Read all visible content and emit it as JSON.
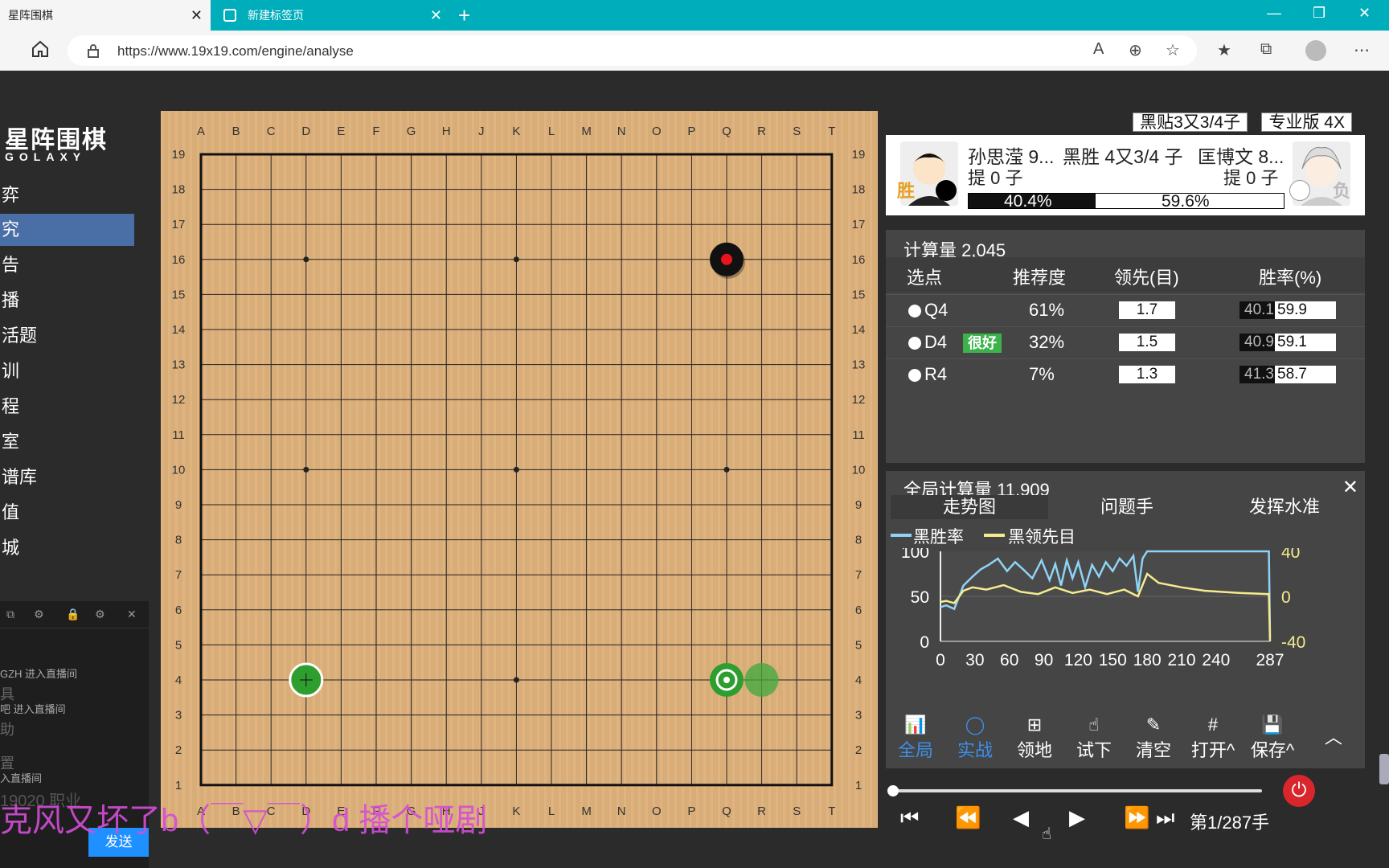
{
  "browser": {
    "tabs": [
      {
        "title": "星阵围棋",
        "active": true
      },
      {
        "title": "新建标签页",
        "active": false
      }
    ],
    "new_tab": "+",
    "url": "https://www.19x19.com/engine/analyse",
    "controls": {
      "minimize": "—",
      "restore": "❐",
      "close": "✕"
    }
  },
  "sidebar": {
    "logo": "星阵围棋",
    "logo_sub": "GOLAXY",
    "nav": [
      "弈",
      "究",
      "告",
      "播",
      "活题",
      "训",
      "程",
      "室",
      "谱库",
      "值",
      "城"
    ],
    "active_index": 1
  },
  "chat": {
    "lines": [
      "GZH 进入直播间",
      "具",
      "吧 进入直播间",
      "助",
      "置",
      "入直播间",
      "19020 职业"
    ],
    "send_label": "发送"
  },
  "board": {
    "size": 19,
    "columns": [
      "A",
      "B",
      "C",
      "D",
      "E",
      "F",
      "G",
      "H",
      "J",
      "K",
      "L",
      "M",
      "N",
      "O",
      "P",
      "Q",
      "R",
      "S",
      "T"
    ],
    "stones": [
      {
        "point": "Q16",
        "color": "black",
        "last_move": true
      }
    ],
    "candidates": [
      {
        "point": "D4",
        "style": "green-ring"
      },
      {
        "point": "Q4",
        "style": "green-best"
      },
      {
        "point": "R4",
        "style": "green-soft"
      }
    ]
  },
  "panel": {
    "komi_badge": "黑贴3又3/4子",
    "version_badge": "专业版 4X",
    "black_player": {
      "name": "孙思滢 9...",
      "captures": "提 0 子",
      "badge": "胜"
    },
    "white_player": {
      "name": "匡博文 8...",
      "captures": "提 0 子",
      "badge": "负"
    },
    "result": "黑胜 4又3/4 子",
    "black_winrate": "40.4%",
    "white_winrate": "59.6%",
    "black_winrate_value": 40.4,
    "analysis": {
      "title": "计算量 2,045",
      "headers": [
        "选点",
        "推荐度",
        "领先(目)",
        "胜率(%)"
      ],
      "rows": [
        {
          "move": "Q4",
          "tag": "",
          "recommend": "61%",
          "lead": "1.7",
          "wr_black": "40.1",
          "wr_white": "59.9"
        },
        {
          "move": "D4",
          "tag": "很好",
          "recommend": "32%",
          "lead": "1.5",
          "wr_black": "40.9",
          "wr_white": "59.1"
        },
        {
          "move": "R4",
          "tag": "",
          "recommend": "7%",
          "lead": "1.3",
          "wr_black": "41.3",
          "wr_white": "58.7"
        }
      ]
    },
    "trend": {
      "title": "全局计算量 11,909",
      "tabs": [
        "走势图",
        "问题手",
        "发挥水准"
      ],
      "legend": [
        "黑胜率",
        "黑领先目"
      ],
      "close": "✕"
    },
    "tools": [
      {
        "icon": "📊",
        "label": "全局",
        "active": true
      },
      {
        "icon": "◯",
        "label": "实战",
        "active": true
      },
      {
        "icon": "⊞",
        "label": "领地",
        "active": false
      },
      {
        "icon": "☝",
        "label": "试下",
        "active": false
      },
      {
        "icon": "✎",
        "label": "清空",
        "active": false
      },
      {
        "icon": "#",
        "label": "打开^",
        "active": false
      },
      {
        "icon": "💾",
        "label": "保存^",
        "active": false
      }
    ],
    "collapse_icon": "︿",
    "move_counter": "第1/287手",
    "playback": [
      "⏮",
      "⏪",
      "◀",
      "▶",
      "⏩",
      "⏭"
    ]
  },
  "danmaku": "克风又坏了b（￣▽￣）d 播个哑剧",
  "colors": {
    "accent_blue": "#4a6ea6",
    "winrate_line": "#8fd3f5",
    "lead_line": "#f5ec8f",
    "good_tag": "#3cb34a",
    "candidate_green": "#2e9e2e"
  },
  "chart_data": {
    "type": "line",
    "x_ticks": [
      0,
      30,
      60,
      90,
      120,
      150,
      180,
      210,
      240,
      287
    ],
    "y_left_ticks": [
      0,
      50,
      100
    ],
    "y_right_ticks": [
      -40,
      0,
      40
    ],
    "xlim": [
      0,
      287
    ],
    "ylim_left": [
      0,
      100
    ],
    "ylim_right": [
      -40,
      40
    ],
    "series": [
      {
        "name": "黑胜率",
        "axis": "left",
        "x": [
          0,
          5,
          12,
          20,
          28,
          35,
          42,
          50,
          58,
          65,
          72,
          80,
          88,
          95,
          100,
          105,
          110,
          115,
          120,
          126,
          132,
          138,
          144,
          150,
          156,
          162,
          168,
          172,
          176,
          180,
          200,
          230,
          260,
          286,
          287
        ],
        "values": [
          38,
          40,
          36,
          62,
          72,
          80,
          85,
          92,
          78,
          88,
          80,
          70,
          90,
          68,
          86,
          62,
          90,
          70,
          88,
          60,
          85,
          72,
          88,
          78,
          92,
          84,
          95,
          55,
          92,
          100,
          100,
          100,
          100,
          100,
          5
        ]
      },
      {
        "name": "黑领先目",
        "axis": "right",
        "x": [
          0,
          5,
          12,
          20,
          28,
          40,
          55,
          70,
          85,
          100,
          115,
          130,
          145,
          160,
          172,
          176,
          180,
          190,
          210,
          230,
          260,
          286,
          287
        ],
        "values": [
          -5,
          -4,
          -6,
          5,
          8,
          6,
          10,
          4,
          2,
          8,
          3,
          6,
          2,
          6,
          0,
          10,
          20,
          12,
          8,
          5,
          3,
          2,
          -40
        ]
      }
    ]
  }
}
